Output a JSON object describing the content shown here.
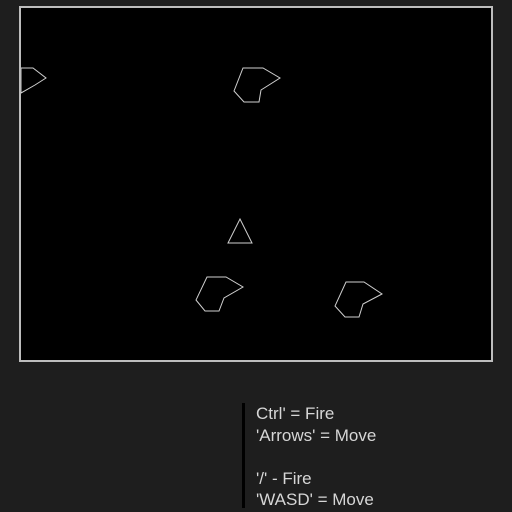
{
  "controls": {
    "player1": {
      "fire": "Ctrl' = Fire",
      "move": "'Arrows' = Move"
    },
    "player2": {
      "fire": "'/' - Fire",
      "move": "'WASD' = Move"
    }
  },
  "colors": {
    "background": "#1e1e1e",
    "canvas": "#000000",
    "canvas_border": "#bdbdbd",
    "stroke": "#cfcfcf",
    "text": "#d6d6d6"
  },
  "icons": {
    "ship": "triangle-ship-icon",
    "asteroid": "polygon-asteroid-icon"
  }
}
